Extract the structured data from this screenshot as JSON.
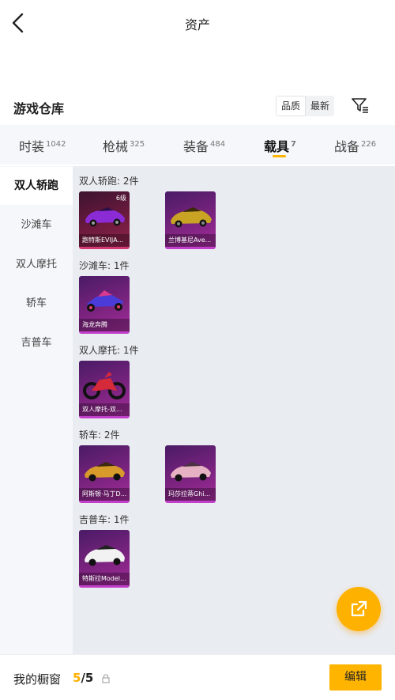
{
  "header": {
    "title": "资产"
  },
  "warehouse": {
    "title": "游戏仓库",
    "sort_options": [
      "品质",
      "最新"
    ],
    "filter_icon": "filter-list-icon"
  },
  "tabs": [
    {
      "label": "时装",
      "count": "1042"
    },
    {
      "label": "枪械",
      "count": "325"
    },
    {
      "label": "装备",
      "count": "484"
    },
    {
      "label": "载具",
      "count": "7"
    },
    {
      "label": "战备",
      "count": "226"
    }
  ],
  "side_nav": [
    "双人轿跑",
    "沙滩车",
    "双人摩托",
    "轿车",
    "吉普车"
  ],
  "groups": [
    {
      "title": "双人轿跑: 2件",
      "items": [
        {
          "label": "跑特斯EVIJA...",
          "badge": "6级",
          "style": "red"
        },
        {
          "label": "兰博基尼Ave...",
          "badge": "",
          "style": "purple"
        }
      ]
    },
    {
      "title": "沙滩车: 1件",
      "items": [
        {
          "label": "海龙奔腾",
          "badge": "",
          "style": "purple"
        }
      ]
    },
    {
      "title": "双人摩托: 1件",
      "items": [
        {
          "label": "双人摩托-双...",
          "badge": "",
          "style": "purple"
        }
      ]
    },
    {
      "title": "轿车: 2件",
      "items": [
        {
          "label": "阿斯顿·马丁D...",
          "badge": "",
          "style": "purple"
        },
        {
          "label": "玛莎拉蒂Ghi...",
          "badge": "",
          "style": "purple"
        }
      ]
    },
    {
      "title": "吉普车: 1件",
      "items": [
        {
          "label": "特斯拉Model...",
          "badge": "",
          "style": "purple"
        }
      ]
    }
  ],
  "bottom": {
    "showcase_label": "我的橱窗",
    "current": "5",
    "separator": "/",
    "max": "5",
    "edit_label": "编辑"
  },
  "colors": {
    "accent": "#ffb400",
    "card_purple": "#7a237e",
    "card_red": "#6c1a3d"
  }
}
